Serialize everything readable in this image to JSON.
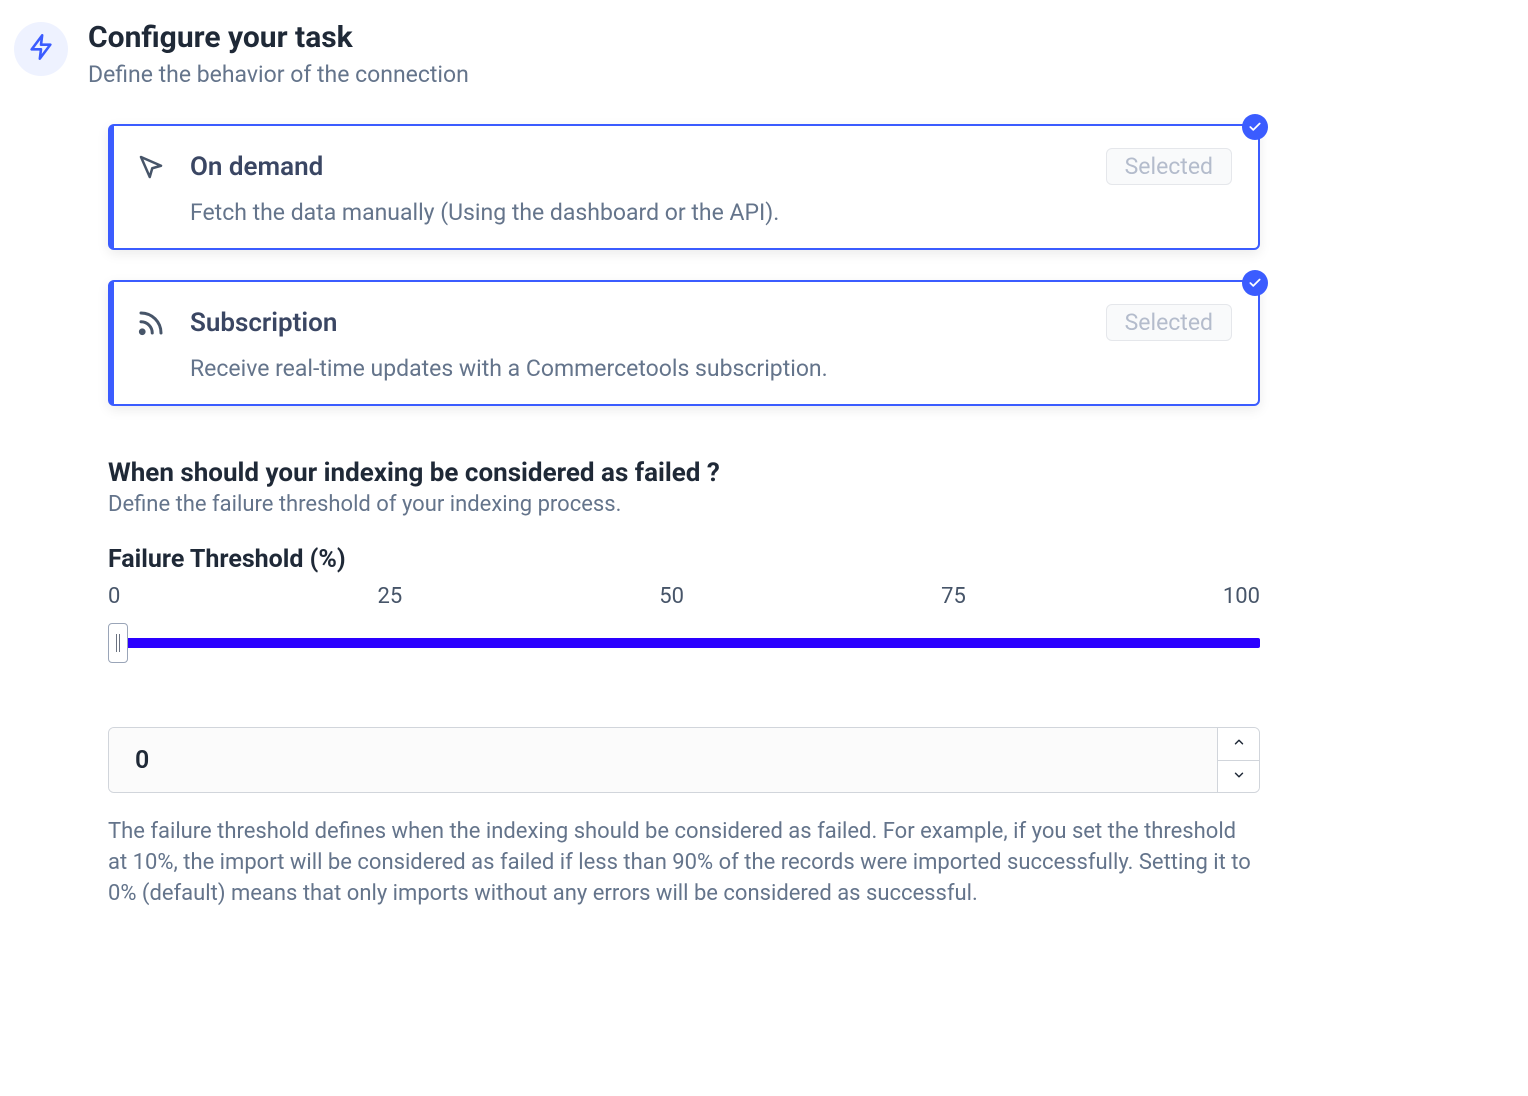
{
  "header": {
    "title": "Configure your task",
    "subtitle": "Define the behavior of the connection"
  },
  "options": [
    {
      "title": "On demand",
      "description": "Fetch the data manually (Using the dashboard or the API).",
      "selected_label": "Selected"
    },
    {
      "title": "Subscription",
      "description": "Receive real-time updates with a Commercetools subscription.",
      "selected_label": "Selected"
    }
  ],
  "failure_section": {
    "title": "When should your indexing be considered as failed ?",
    "subtitle": "Define the failure threshold of your indexing process.",
    "field_label": "Failure Threshold (%)",
    "ticks": [
      "0",
      "25",
      "50",
      "75",
      "100"
    ],
    "value": "0",
    "help_text": "The failure threshold defines when the indexing should be considered as failed. For example, if you set the threshold at 10%, the import will be considered as failed if less than 90% of the records were imported successfully. Setting it to 0% (default) means that only imports without any errors will be considered as successful."
  }
}
